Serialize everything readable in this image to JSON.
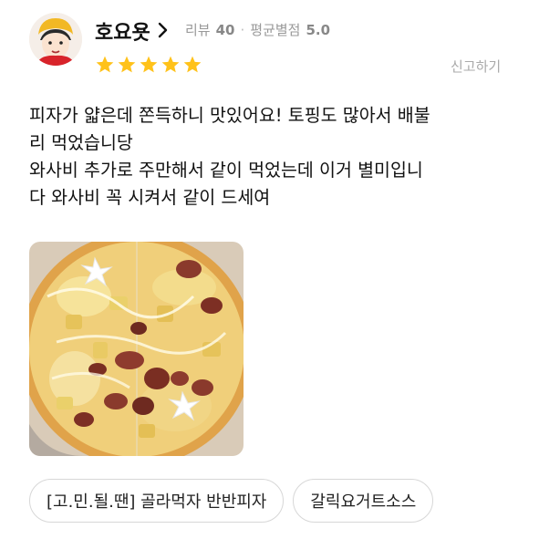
{
  "reviewer": {
    "name": "호요욧",
    "reviews_label": "리뷰",
    "reviews_count": "40",
    "rating_label": "평균별점",
    "rating_value": "5.0"
  },
  "rating": {
    "stars": 5,
    "max": 5,
    "star_color": "#FFC21A"
  },
  "report_label": "신고하기",
  "review_text": [
    "피자가 얇은데 쫀득하니 맛있어요! 토핑도 많아서 배불",
    "리 먹었습니당",
    "와사비 추가로 주만해서 같이 먹었는데 이거 별미입니",
    "다 와사비 꼭 시켜서 같이 드세여"
  ],
  "tags": [
    "[고.민.될.땐] 골라먹자 반반피자",
    "갈릭요거트소스"
  ]
}
